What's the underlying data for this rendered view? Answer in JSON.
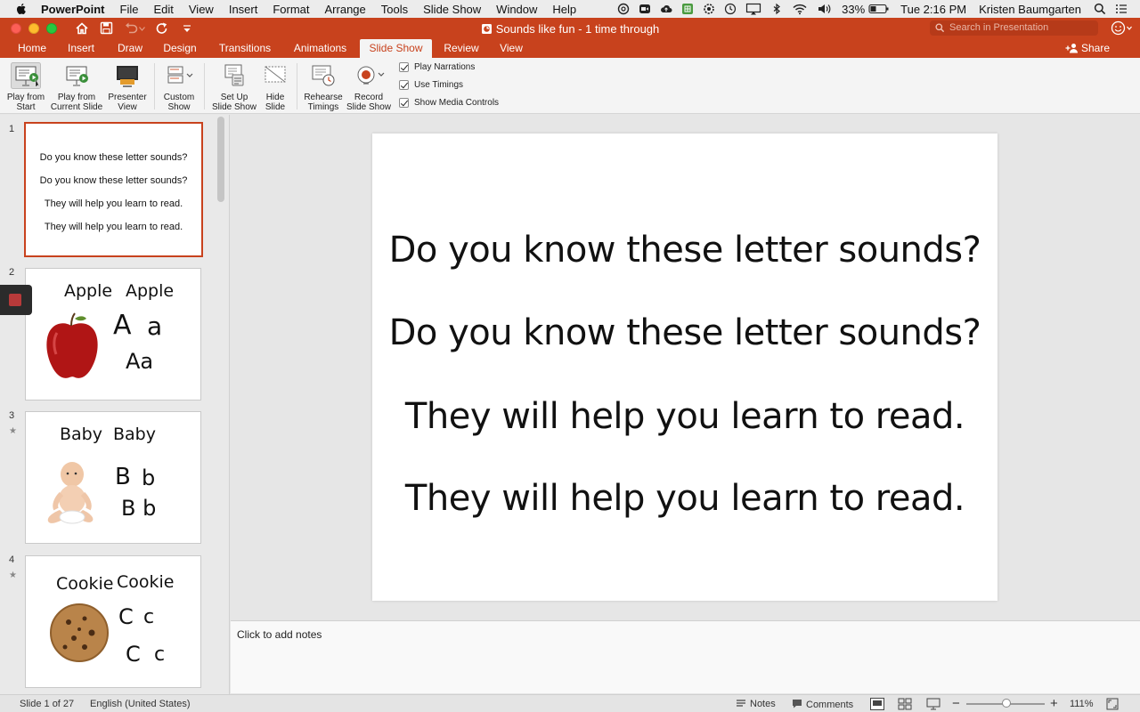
{
  "menubar": {
    "app_name": "PowerPoint",
    "items": [
      "File",
      "Edit",
      "View",
      "Insert",
      "Format",
      "Arrange",
      "Tools",
      "Slide Show",
      "Window",
      "Help"
    ],
    "battery": "33%",
    "clock": "Tue 2:16 PM",
    "user": "Kristen Baumgarten"
  },
  "window": {
    "title": "Sounds like fun - 1 time through",
    "search_placeholder": "Search in Presentation",
    "share_label": "Share"
  },
  "tabs": [
    {
      "label": "Home"
    },
    {
      "label": "Insert"
    },
    {
      "label": "Draw"
    },
    {
      "label": "Design"
    },
    {
      "label": "Transitions"
    },
    {
      "label": "Animations"
    },
    {
      "label": "Slide Show",
      "active": true
    },
    {
      "label": "Review"
    },
    {
      "label": "View"
    }
  ],
  "ribbon": {
    "play_from_start": [
      "Play from",
      "Start"
    ],
    "play_from_current": [
      "Play from",
      "Current Slide"
    ],
    "presenter_view": [
      "Presenter",
      "View"
    ],
    "custom_show": [
      "Custom",
      "Show"
    ],
    "set_up": [
      "Set Up",
      "Slide Show"
    ],
    "hide_slide": [
      "Hide",
      "Slide"
    ],
    "rehearse": [
      "Rehearse",
      "Timings"
    ],
    "record": [
      "Record",
      "Slide Show"
    ],
    "checks": [
      {
        "label": "Play Narrations",
        "checked": true
      },
      {
        "label": "Use Timings",
        "checked": true
      },
      {
        "label": "Show Media Controls",
        "checked": true
      }
    ]
  },
  "thumbnails": [
    {
      "num": "1",
      "lines": [
        "Do you know these letter sounds?",
        "Do you know these letter sounds?",
        "They will help you learn to read.",
        "They will help you learn to read."
      ]
    },
    {
      "num": "2",
      "words": [
        "Apple",
        "Apple"
      ],
      "letters": [
        "A",
        "a",
        "Aa"
      ],
      "picture": "apple"
    },
    {
      "num": "3",
      "star": "★",
      "words": [
        "Baby",
        "Baby"
      ],
      "letters": [
        "B",
        "b",
        "B b"
      ],
      "picture": "baby"
    },
    {
      "num": "4",
      "star": "★",
      "words": [
        "Cookie",
        "Cookie"
      ],
      "letters": [
        "C",
        "c",
        "C",
        "c"
      ],
      "picture": "cookie"
    }
  ],
  "slide": {
    "lines": [
      "Do you know these letter sounds?",
      "Do you know these letter sounds?",
      "They will help you learn to read.",
      "They will help you learn to read."
    ]
  },
  "notes": {
    "placeholder": "Click to add notes"
  },
  "status": {
    "slide_counter": "Slide 1 of 27",
    "language": "English (United States)",
    "notes_label": "Notes",
    "comments_label": "Comments",
    "zoom": "111%"
  },
  "colors": {
    "accent": "#c8421d",
    "selection": "#c8421d"
  }
}
